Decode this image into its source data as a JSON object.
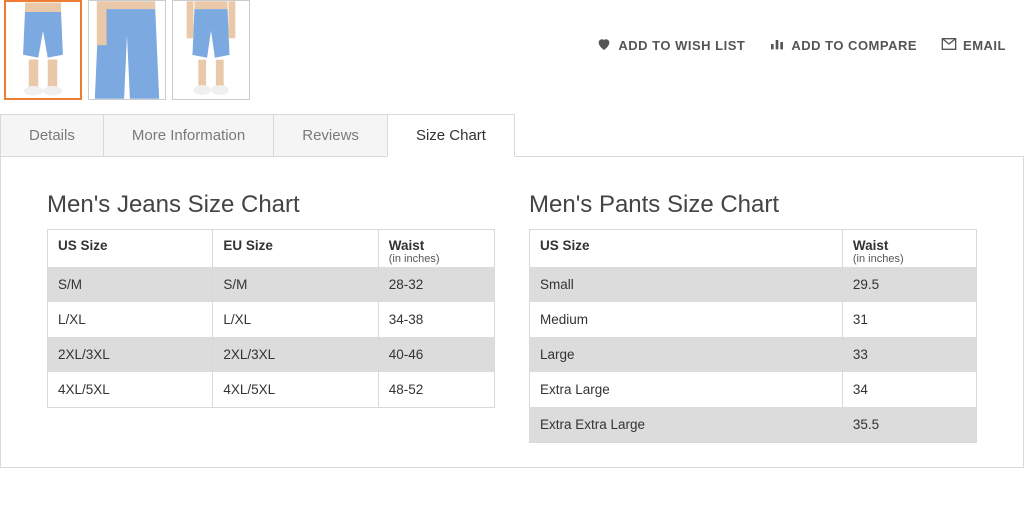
{
  "actions": {
    "wishlist": "ADD TO WISH LIST",
    "compare": "ADD TO COMPARE",
    "email": "EMAIL"
  },
  "tabs": {
    "details": "Details",
    "more_info": "More Information",
    "reviews": "Reviews",
    "size_chart": "Size Chart"
  },
  "jeans_chart": {
    "title": "Men's Jeans Size Chart",
    "headers": {
      "us": "US Size",
      "eu": "EU Size",
      "waist": "Waist",
      "waist_sub": "(in inches)"
    },
    "rows": [
      {
        "us": "S/M",
        "eu": "S/M",
        "waist": "28-32"
      },
      {
        "us": "L/XL",
        "eu": "L/XL",
        "waist": "34-38"
      },
      {
        "us": "2XL/3XL",
        "eu": "2XL/3XL",
        "waist": "40-46"
      },
      {
        "us": "4XL/5XL",
        "eu": "4XL/5XL",
        "waist": "48-52"
      }
    ]
  },
  "pants_chart": {
    "title": "Men's Pants Size Chart",
    "headers": {
      "us": "US Size",
      "waist": "Waist",
      "waist_sub": "(in inches)"
    },
    "rows": [
      {
        "us": "Small",
        "waist": "29.5"
      },
      {
        "us": "Medium",
        "waist": "31"
      },
      {
        "us": "Large",
        "waist": "33"
      },
      {
        "us": "Extra Large",
        "waist": "34"
      },
      {
        "us": "Extra Extra Large",
        "waist": "35.5"
      }
    ]
  }
}
